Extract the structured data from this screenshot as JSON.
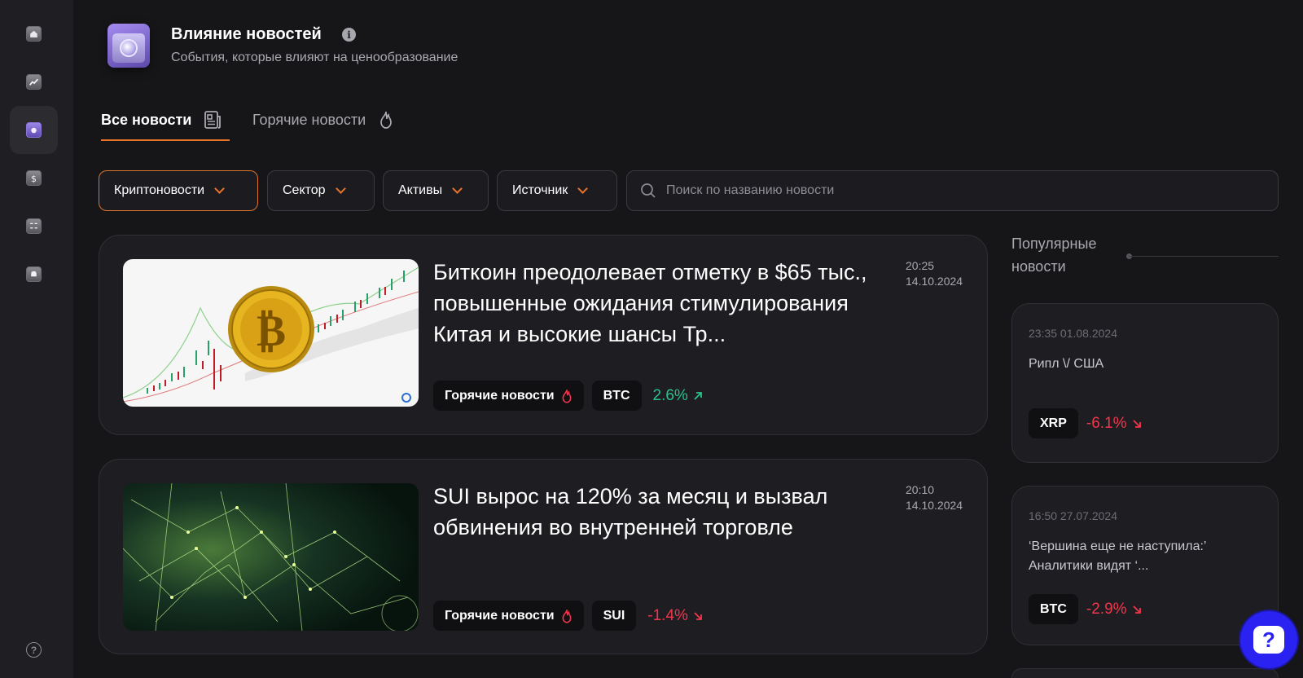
{
  "header": {
    "title": "Влияние новостей",
    "subtitle": "События, которые влияют на ценообразование"
  },
  "tabs": [
    {
      "label": "Все новости"
    },
    {
      "label": "Горячие новости"
    }
  ],
  "filters": [
    {
      "label": "Криптоновости"
    },
    {
      "label": "Сектор"
    },
    {
      "label": "Активы"
    },
    {
      "label": "Источник"
    }
  ],
  "search": {
    "placeholder": "Поиск по названию новости"
  },
  "news": [
    {
      "title": "Биткоин преодолевает отметку в $65 тыс., повышенные ожидания стимулирования Китая и высокие шансы Тр...",
      "time": "20:25",
      "date": "14.10.2024",
      "tag": "Горячие новости",
      "asset": "BTC",
      "change": "2.6%",
      "direction": "up"
    },
    {
      "title": "SUI вырос на 120% за месяц и вызвал обвинения во внутренней торговле",
      "time": "20:10",
      "date": "14.10.2024",
      "tag": "Горячие новости",
      "asset": "SUI",
      "change": "-1.4%",
      "direction": "down"
    }
  ],
  "popular": {
    "title": "Популярные новости",
    "items": [
      {
        "datetime": "23:35 01.08.2024",
        "text": "Рипл \\/ США",
        "asset": "XRP",
        "change": "-6.1%"
      },
      {
        "datetime": "16:50 27.07.2024",
        "text": "‘Вершина еще не наступила:’ Аналитики видят ‘...",
        "asset": "BTC",
        "change": "-2.9%"
      }
    ]
  },
  "colors": {
    "accent": "#e8742a",
    "positive": "#27c38a",
    "negative": "#f0364c",
    "help_button": "#2a22f0"
  },
  "icons": [
    "home-icon",
    "chart-icon",
    "news-icon",
    "dollar-icon",
    "calculator-icon",
    "bell-icon",
    "help-icon",
    "info-icon",
    "newspaper-icon",
    "flame-icon",
    "search-icon",
    "chevron-down-icon"
  ]
}
